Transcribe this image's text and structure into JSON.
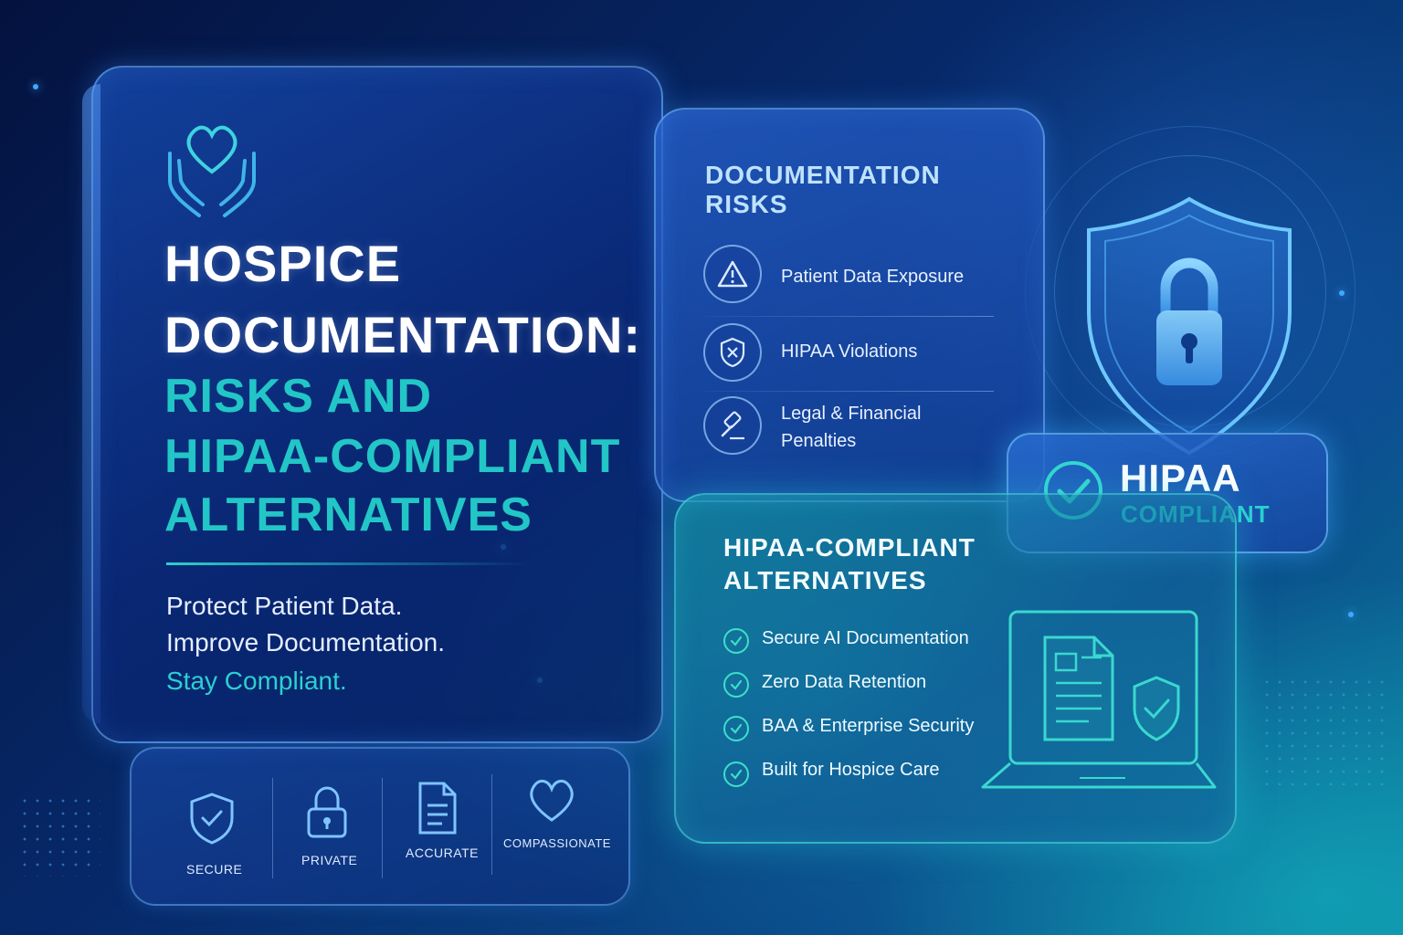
{
  "hero": {
    "title_line1": "HOSPICE",
    "title_line2": "DOCUMENTATION:",
    "title_line3": "RISKS AND",
    "title_line4": "HIPAA-COMPLIANT",
    "title_line5": "ALTERNATIVES",
    "tagline1": "Protect Patient Data.",
    "tagline2": "Improve Documentation.",
    "tagline3": "Stay Compliant."
  },
  "risks": {
    "title_line1": "DOCUMENTATION",
    "title_line2": "RISKS",
    "items": [
      {
        "label": "Patient Data Exposure",
        "icon": "warning-icon"
      },
      {
        "label": "HIPAA Violations",
        "icon": "shield-x-icon"
      },
      {
        "label_line1": "Legal & Financial",
        "label_line2": "Penalties",
        "icon": "gavel-icon"
      }
    ]
  },
  "badge": {
    "word": "HIPAA",
    "sub": "COMPLIANT",
    "icon": "check-circle-icon"
  },
  "alternatives": {
    "title_line1": "HIPAA-COMPLIANT",
    "title_line2": "ALTERNATIVES",
    "items": [
      "Secure AI Documentation",
      "Zero Data Retention",
      "BAA & Enterprise Security",
      "Built for Hospice Care"
    ]
  },
  "features": [
    {
      "label": "SECURE",
      "icon": "shield-check-icon"
    },
    {
      "label": "PRIVATE",
      "icon": "padlock-icon"
    },
    {
      "label": "ACCURATE",
      "icon": "document-icon"
    },
    {
      "label": "COMPASSIONATE",
      "icon": "heart-icon"
    }
  ],
  "colors": {
    "background": "#072a6b",
    "accent_teal": "#22c6c6",
    "panel_border": "#78beff"
  }
}
